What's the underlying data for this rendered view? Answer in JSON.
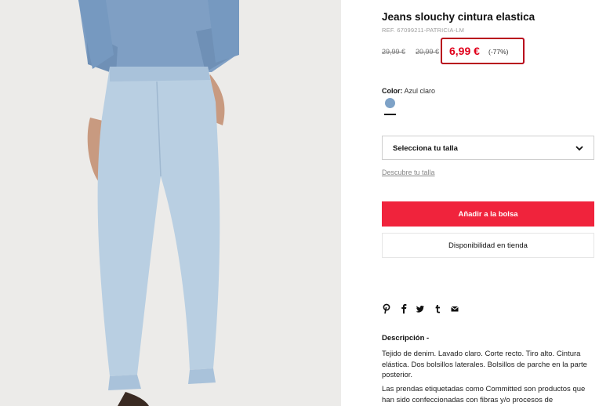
{
  "product": {
    "title": "Jeans slouchy cintura elastica",
    "ref": "REF. 67099211-PATRICIA-LM",
    "original_price_1": "29,99 €",
    "original_price_2": "20,99 €",
    "current_price": "6,99 €",
    "discount": "(-77%)"
  },
  "color": {
    "label": "Color:",
    "value": "Azul claro",
    "swatch_hex": "#7ea2c7"
  },
  "size": {
    "select_label": "Selecciona tu talla",
    "guide_link": "Descubre tu talla"
  },
  "actions": {
    "add_to_bag": "Añadir a la bolsa",
    "store_availability": "Disponibilidad en tienda"
  },
  "share": {
    "icons": [
      "pinterest-icon",
      "facebook-icon",
      "twitter-icon",
      "tumblr-icon",
      "email-icon"
    ]
  },
  "description": {
    "title": "Descripción -",
    "text": "Tejido de denim. Lavado claro. Corte recto. Tiro alto. Cintura elástica. Dos bolsillos laterales. Bolsillos de parche en la parte posterior.",
    "text2": "Las prendas etiquetadas como Committed son productos que han sido confeccionadas con fibras y/o procesos de"
  },
  "colors": {
    "accent_red": "#f0233c",
    "price_red": "#e0001b",
    "highlight_box": "#b8001c"
  }
}
